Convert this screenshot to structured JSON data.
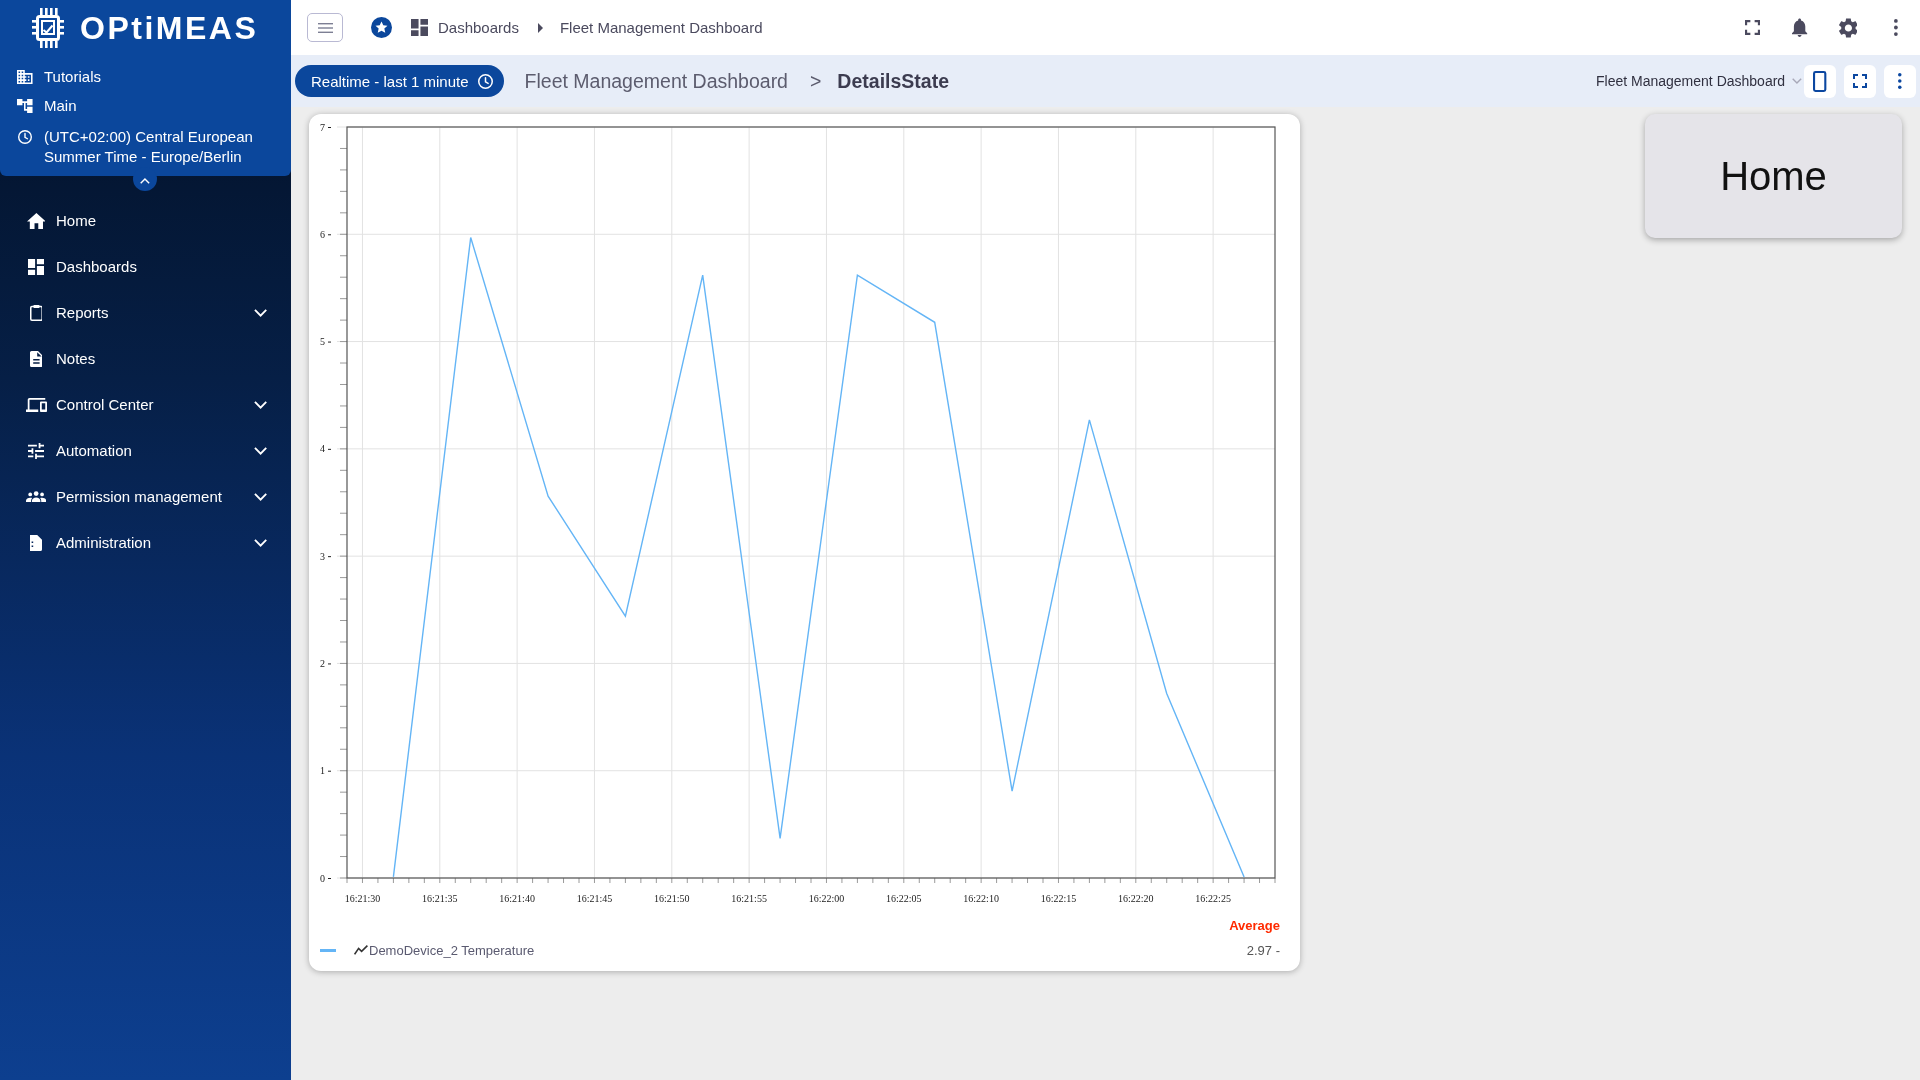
{
  "sidebar": {
    "logo": "OPtiMEAS",
    "context_panel": {
      "expanded": true,
      "items": [
        {
          "label": "Tutorials"
        },
        {
          "label": "Main"
        },
        {
          "label": "(UTC+02:00) Central European Summer Time - Europe/Berlin"
        }
      ]
    },
    "nav": [
      {
        "label": "Home",
        "kind": "link",
        "selected": false
      },
      {
        "label": "Dashboards",
        "kind": "link",
        "selected": false
      },
      {
        "label": "Reports",
        "kind": "group",
        "expanded": false,
        "selected": false
      },
      {
        "label": "Notes",
        "kind": "link",
        "selected": false
      },
      {
        "label": "Control Center",
        "kind": "group",
        "expanded": false,
        "selected": false
      },
      {
        "label": "Automation",
        "kind": "group",
        "expanded": false,
        "selected": false
      },
      {
        "label": "Permission management",
        "kind": "group",
        "expanded": false,
        "selected": false
      },
      {
        "label": "Administration",
        "kind": "group",
        "expanded": false,
        "selected": false
      }
    ]
  },
  "topbar": {
    "breadcrumb": [
      {
        "label": "Dashboards"
      },
      {
        "label": "Fleet Management Dashboard"
      }
    ]
  },
  "toolbar": {
    "time_range": "Realtime - last 1 minute",
    "path": [
      {
        "label": "Fleet Management Dashboard",
        "current": false
      },
      {
        "label": "DetailsState",
        "current": true
      }
    ],
    "path_separator": ">",
    "dashboard_select": "Fleet Management Dashboard"
  },
  "widgets": {
    "chart": {
      "chart_data": {
        "type": "line",
        "grid": true,
        "categories": [
          null,
          "16:21:30",
          null,
          null,
          null,
          null,
          "16:21:35",
          null,
          null,
          null,
          null,
          "16:21:40",
          null,
          null,
          null,
          null,
          "16:21:45",
          null,
          null,
          null,
          null,
          "16:21:50",
          null,
          null,
          null,
          null,
          "16:21:55",
          null,
          null,
          null,
          null,
          "16:22:00",
          null,
          null,
          null,
          null,
          "16:22:05",
          null,
          null,
          null,
          null,
          "16:22:10",
          null,
          null,
          null,
          null,
          "16:22:15",
          null,
          null,
          null,
          null,
          "16:22:20",
          null,
          null,
          null,
          null,
          "16:22:25",
          null,
          null,
          null,
          null
        ],
        "series": [
          {
            "name": "DemoDevice_2 Temperature",
            "color": "#64b5f6",
            "values": [
              null,
              null,
              null,
              0.01,
              null,
              null,
              null,
              null,
              5.97,
              null,
              null,
              null,
              null,
              3.56,
              null,
              null,
              null,
              null,
              2.44,
              null,
              null,
              null,
              null,
              5.62,
              null,
              null,
              null,
              null,
              0.37,
              null,
              null,
              null,
              null,
              5.62,
              null,
              null,
              null,
              null,
              5.18,
              null,
              null,
              null,
              null,
              0.81,
              null,
              null,
              null,
              null,
              4.27,
              null,
              null,
              null,
              null,
              1.72,
              null,
              null,
              null,
              null,
              0.01,
              null,
              null
            ]
          }
        ],
        "ylim": [
          0,
          7
        ],
        "yticks": [
          0,
          1,
          2,
          3,
          4,
          5,
          6,
          7
        ]
      },
      "legend": {
        "header": "Average",
        "rows": [
          {
            "average": "2.97 -"
          }
        ]
      }
    },
    "home_button": "Home"
  }
}
